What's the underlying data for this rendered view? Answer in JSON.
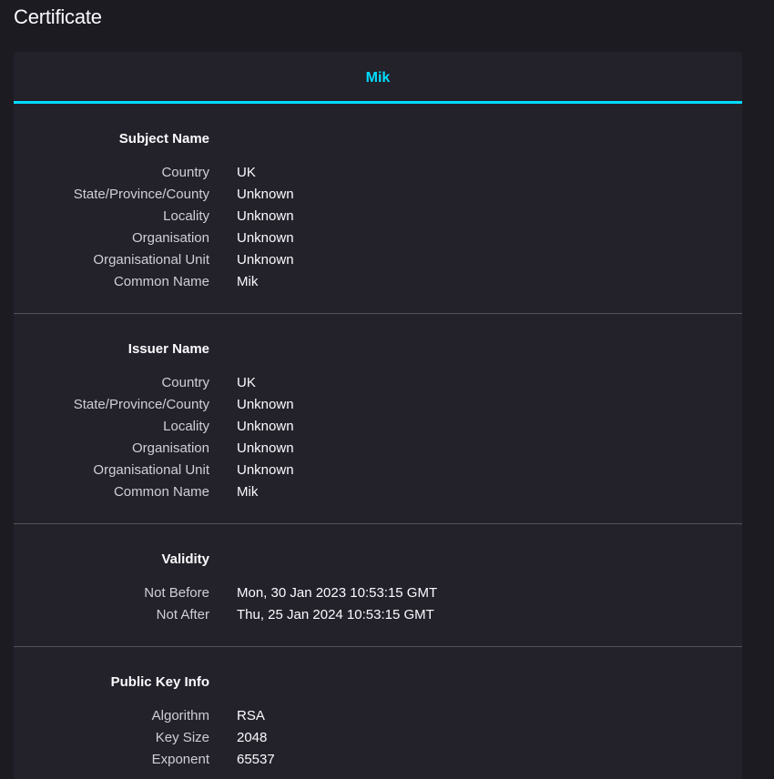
{
  "page": {
    "title": "Certificate"
  },
  "tabs": [
    {
      "label": "Mik"
    }
  ],
  "subject": {
    "title": "Subject Name",
    "rows": [
      {
        "label": "Country",
        "value": "UK"
      },
      {
        "label": "State/Province/County",
        "value": "Unknown"
      },
      {
        "label": "Locality",
        "value": "Unknown"
      },
      {
        "label": "Organisation",
        "value": "Unknown"
      },
      {
        "label": "Organisational Unit",
        "value": "Unknown"
      },
      {
        "label": "Common Name",
        "value": "Mik"
      }
    ]
  },
  "issuer": {
    "title": "Issuer Name",
    "rows": [
      {
        "label": "Country",
        "value": "UK"
      },
      {
        "label": "State/Province/County",
        "value": "Unknown"
      },
      {
        "label": "Locality",
        "value": "Unknown"
      },
      {
        "label": "Organisation",
        "value": "Unknown"
      },
      {
        "label": "Organisational Unit",
        "value": "Unknown"
      },
      {
        "label": "Common Name",
        "value": "Mik"
      }
    ]
  },
  "validity": {
    "title": "Validity",
    "rows": [
      {
        "label": "Not Before",
        "value": "Mon, 30 Jan 2023 10:53:15 GMT"
      },
      {
        "label": "Not After",
        "value": "Thu, 25 Jan 2024 10:53:15 GMT"
      }
    ]
  },
  "public_key": {
    "title": "Public Key Info",
    "rows": [
      {
        "label": "Algorithm",
        "value": "RSA"
      },
      {
        "label": "Key Size",
        "value": "2048"
      },
      {
        "label": "Exponent",
        "value": "65537"
      }
    ]
  },
  "colors": {
    "background": "#1c1b22",
    "card": "#23222b",
    "accent": "#00ddff",
    "divider": "#52525e",
    "label": "#cfcfd8",
    "text": "#fbfbfe"
  }
}
